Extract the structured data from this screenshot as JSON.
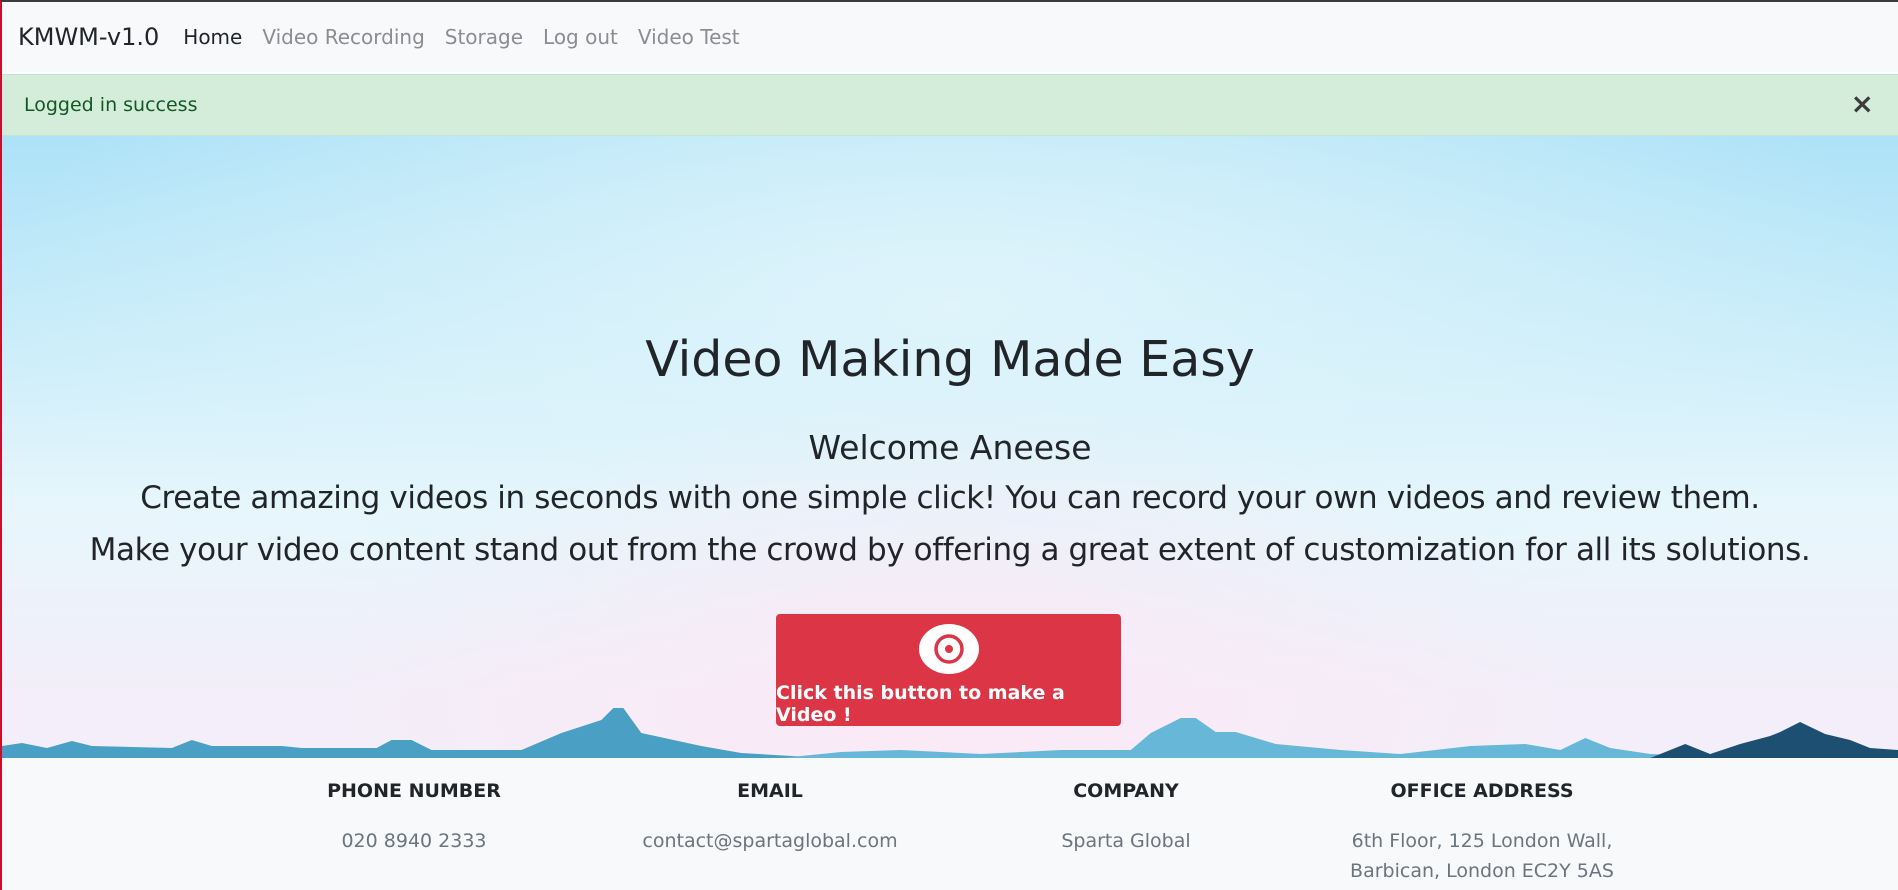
{
  "navbar": {
    "brand": "KMWM-v1.0",
    "links": [
      "Home",
      "Video Recording",
      "Storage",
      "Log out",
      "Video Test"
    ]
  },
  "alert": {
    "message": "Logged in success",
    "close_symbol": "×"
  },
  "hero": {
    "title": "Video Making Made Easy",
    "welcome": "Welcome Aneese",
    "line1": "Create amazing videos in seconds with one simple click! You can record your own videos and review them.",
    "line2": "Make your video content stand out from the crowd by offering a great extent of customization for all its solutions.",
    "cta_label": "Click this button to make a Video !",
    "cta_icon": "record-target-icon"
  },
  "footer": {
    "phone": {
      "heading": "PHONE NUMBER",
      "value": "020 8940 2333"
    },
    "email": {
      "heading": "EMAIL",
      "value": "contact@spartaglobal.com"
    },
    "company": {
      "heading": "COMPANY",
      "value": "Sparta Global"
    },
    "address": {
      "heading": "OFFICE ADDRESS",
      "line1": "6th Floor, 125 London Wall,",
      "line2": "Barbican, London EC2Y 5AS"
    }
  },
  "colors": {
    "cta": "#dc3545",
    "alert_bg": "#d4edda",
    "alert_text": "#155724",
    "navbar_bg": "#f8f9fa"
  }
}
